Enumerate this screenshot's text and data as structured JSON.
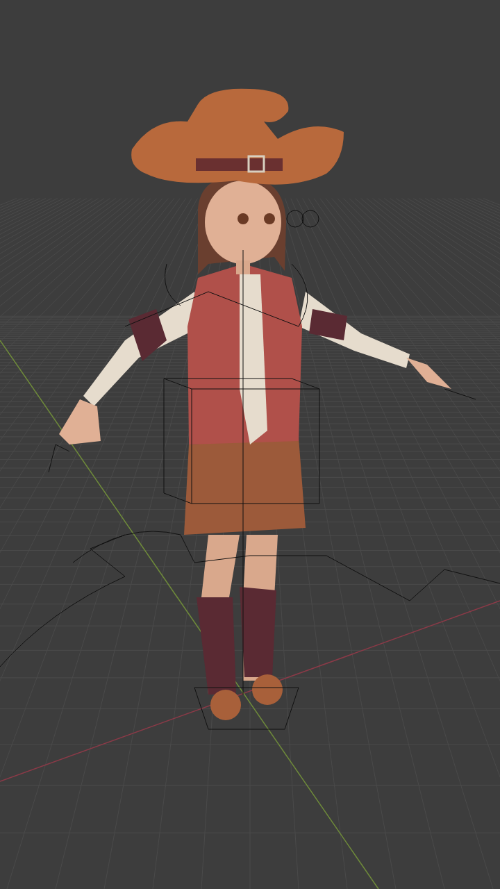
{
  "viewport": {
    "grid": true,
    "axes": [
      {
        "kind": "x",
        "color": "#8c3a48"
      },
      {
        "kind": "y",
        "color": "#6f8c3a"
      }
    ],
    "model": {
      "armature_visible": true
    }
  }
}
